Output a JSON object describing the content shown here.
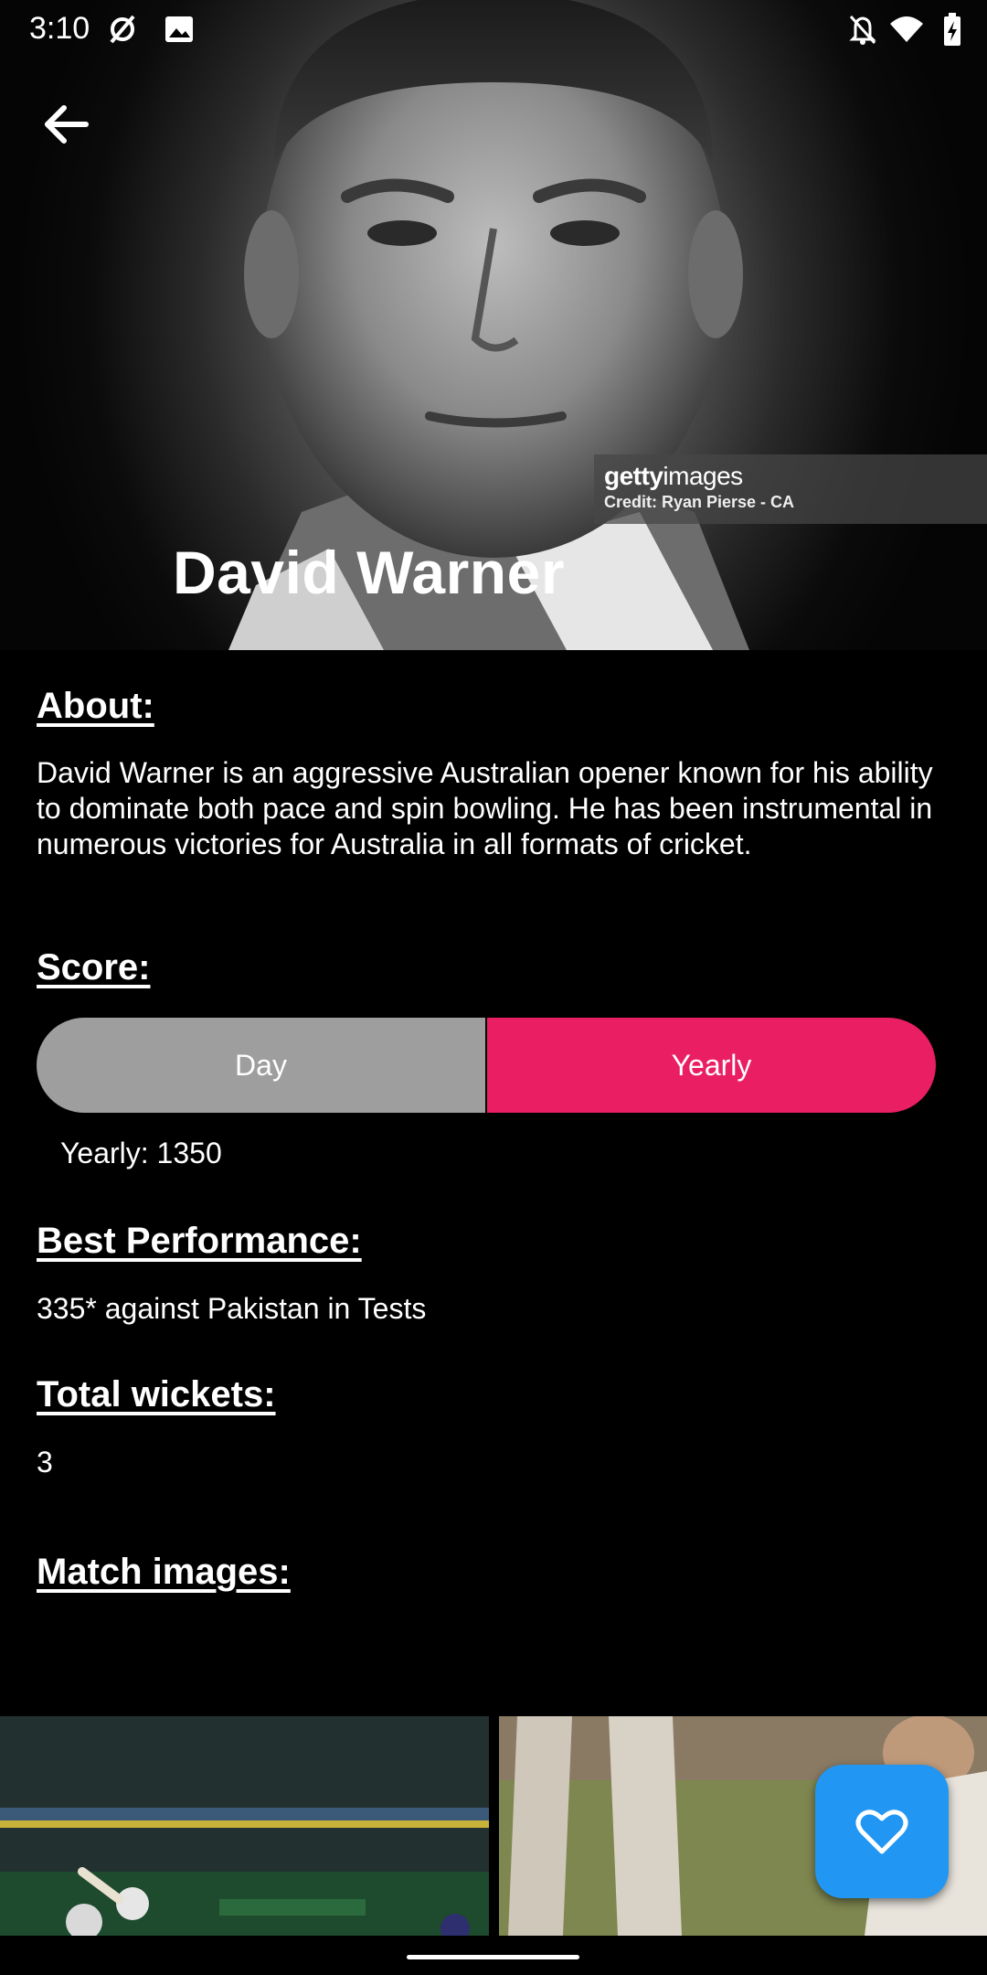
{
  "status_bar": {
    "time": "3:10"
  },
  "header": {
    "player_name": "David Warner",
    "image_watermark_brand": "getty",
    "image_watermark_brand_suffix": "images",
    "image_credit": "Credit: Ryan Pierse - CA"
  },
  "about": {
    "title": "About:",
    "text": "David Warner is an aggressive Australian opener known for his ability to dominate both pace and spin bowling. He has been instrumental in numerous victories for Australia in all formats of cricket."
  },
  "score": {
    "title": "Score:",
    "options": [
      "Day",
      "Yearly"
    ],
    "selected": "Yearly",
    "value_text": "Yearly: 1350"
  },
  "best_performance": {
    "title": "Best Performance:",
    "text": "335* against Pakistan in Tests"
  },
  "wickets": {
    "title": "Total wickets:",
    "value": "3"
  },
  "match_images": {
    "title": "Match images:"
  },
  "colors": {
    "accent_pink": "#e91e63",
    "segment_inactive": "#9e9e9e",
    "fab_blue": "#2196f3",
    "background": "#000000"
  },
  "icons": {
    "back": "arrow-left-icon",
    "favorite": "heart-outline-icon"
  }
}
